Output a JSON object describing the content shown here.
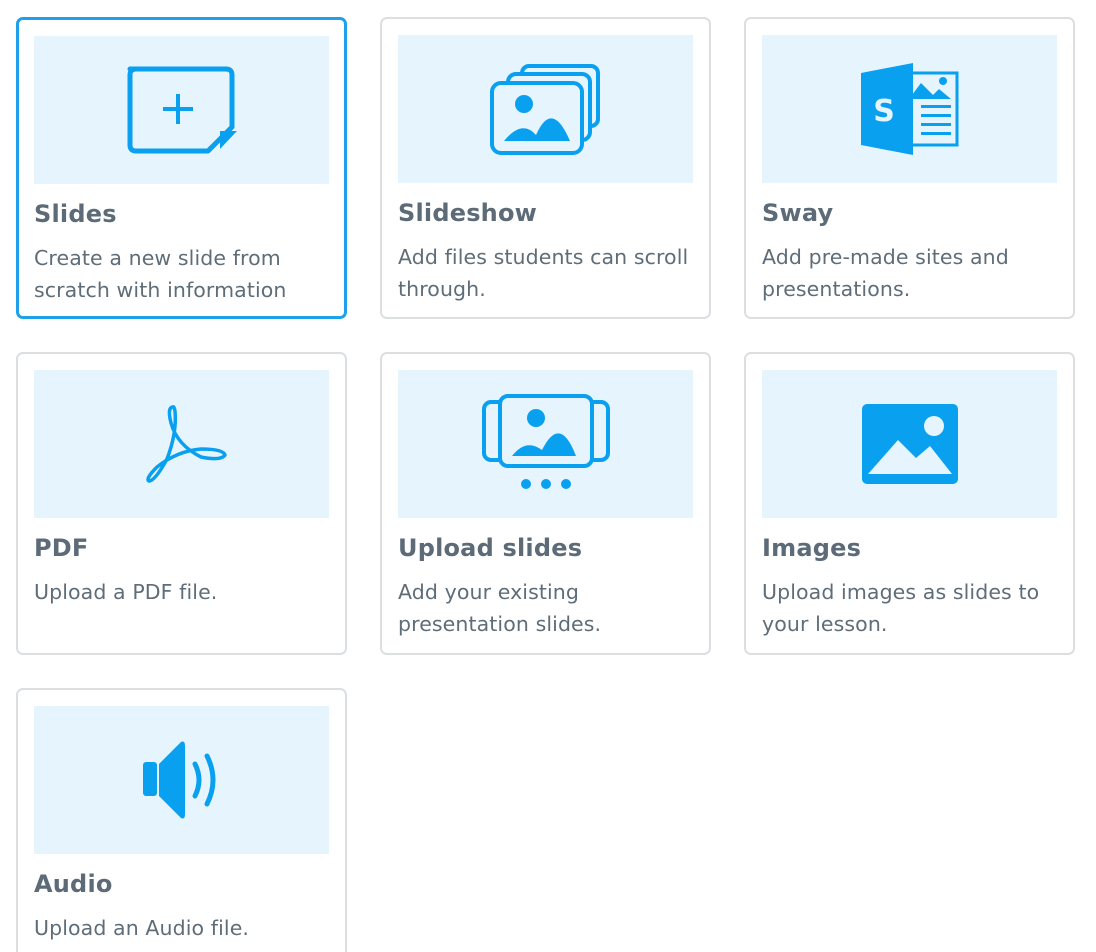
{
  "colors": {
    "accent": "#1ea1ea",
    "icon": "#0aa0f0",
    "thumb_bg": "#e6f5fd",
    "title": "#5c6b77",
    "desc": "#5f6d79",
    "border": "#dcdfe2"
  },
  "cards": [
    {
      "title": "Slides",
      "description": "Create a new slide from scratch with information",
      "icon": "new-slide-icon",
      "selected": true
    },
    {
      "title": "Slideshow",
      "description": "Add files students can scroll through.",
      "icon": "slideshow-icon",
      "selected": false
    },
    {
      "title": "Sway",
      "description": "Add pre-made sites and presentations.",
      "icon": "sway-icon",
      "selected": false
    },
    {
      "title": "PDF",
      "description": "Upload a PDF file.",
      "icon": "pdf-icon",
      "selected": false
    },
    {
      "title": "Upload slides",
      "description": "Add your existing presentation slides.",
      "icon": "upload-slides-icon",
      "selected": false
    },
    {
      "title": "Images",
      "description": "Upload images as slides to your lesson.",
      "icon": "image-icon",
      "selected": false
    },
    {
      "title": "Audio",
      "description": "Upload an Audio file.",
      "icon": "audio-icon",
      "selected": false
    }
  ]
}
